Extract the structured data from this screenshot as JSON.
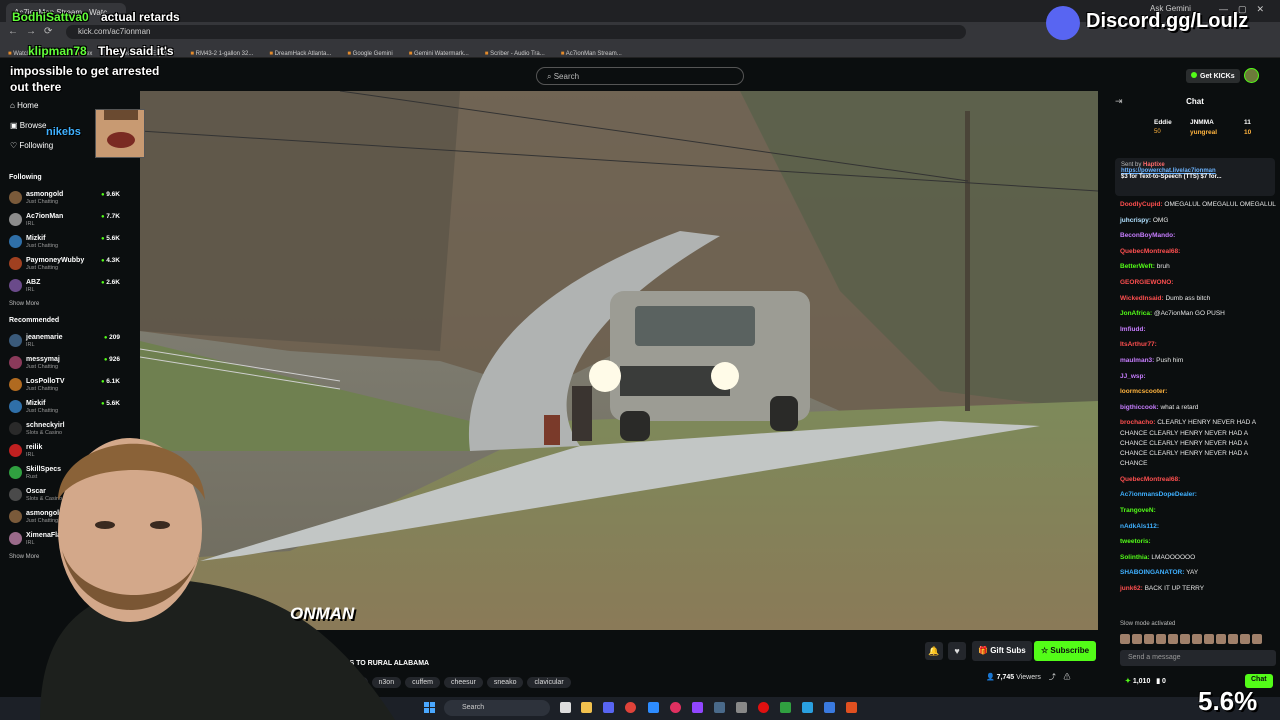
{
  "browser": {
    "tab_title": "Ac7ionMan Stream - Watc",
    "gemini_tab": "Ask Gemini",
    "url": "kick.com/ac7ionman",
    "bookmarks": [
      "Watch on Stream",
      "Plex",
      "Saved",
      "Explorer",
      "RM43-2 1-gallon 32...",
      "DreamHack Atlanta...",
      "Google Gemini",
      "Gemini Watermark...",
      "Scriber - Audio Tra...",
      "Ac7ionMan Stream..."
    ]
  },
  "header": {
    "search_placeholder": "Search",
    "get_kicks": "Get KICKs"
  },
  "sidebar": {
    "nav": [
      {
        "label": "Home",
        "icon": "home-icon"
      },
      {
        "label": "Browse",
        "icon": "browse-icon"
      },
      {
        "label": "Following",
        "icon": "heart-icon"
      }
    ],
    "following_heading": "Following",
    "following": [
      {
        "name": "asmongold",
        "category": "Just Chatting",
        "viewers": "9.6K",
        "color": "#7a5a3a"
      },
      {
        "name": "Ac7ionMan",
        "category": "IRL",
        "viewers": "7.7K",
        "color": "#8c8c8c"
      },
      {
        "name": "Mizkif",
        "category": "Just Chatting",
        "viewers": "5.6K",
        "color": "#2f6fa8"
      },
      {
        "name": "PaymoneyWubby",
        "category": "Just Chatting",
        "viewers": "4.3K",
        "color": "#a04020"
      },
      {
        "name": "ABZ",
        "category": "IRL",
        "viewers": "2.6K",
        "color": "#6a4a8a"
      }
    ],
    "show_more": "Show More",
    "recommended_heading": "Recommended",
    "recommended": [
      {
        "name": "jeanemarie",
        "category": "IRL",
        "viewers": "209",
        "color": "#3a5a7a"
      },
      {
        "name": "messymaj",
        "category": "Just Chatting",
        "viewers": "926",
        "color": "#8a3a5a"
      },
      {
        "name": "LosPolloTV",
        "category": "Just Chatting",
        "viewers": "6.1K",
        "color": "#b06a20"
      },
      {
        "name": "Mizkif",
        "category": "Just Chatting",
        "viewers": "5.6K",
        "color": "#2f6fa8"
      },
      {
        "name": "schneckyirl",
        "category": "Slots & Casino",
        "viewers": "",
        "color": "#2a2a2a"
      },
      {
        "name": "reilik",
        "category": "IRL",
        "viewers": "",
        "color": "#c02020"
      },
      {
        "name": "SkillSpecs",
        "category": "Rust",
        "viewers": "",
        "color": "#30a040"
      },
      {
        "name": "Oscar",
        "category": "Slots & Casino",
        "viewers": "",
        "color": "#4a4a4a"
      },
      {
        "name": "asmongold",
        "category": "Just Chatting",
        "viewers": "",
        "color": "#7a5a3a"
      },
      {
        "name": "XimenaFlaku",
        "category": "IRL",
        "viewers": "",
        "color": "#9a6a8a"
      }
    ],
    "show_more_2": "Show More"
  },
  "stream": {
    "title": "MPHIS TO RURAL ALABAMA",
    "tags": [
      "nman",
      "n3on",
      "cuffem",
      "cheesur",
      "sneako",
      "clavicular"
    ],
    "gift_subs": "Gift Subs",
    "subscribe": "Subscribe",
    "viewers": "7,745",
    "viewers_label": "Viewers",
    "watermark": "ONMAN"
  },
  "chat": {
    "title": "Chat",
    "leaderboard": [
      {
        "name": "Eddie",
        "value": "50"
      },
      {
        "name": "JNMMA",
        "value": "11"
      },
      {
        "name": "yungreal",
        "value": "10"
      }
    ],
    "pinned": {
      "sent_by": "Sent by",
      "sender": "Haptixe",
      "link": "https://powerchat.live/ac7ionman",
      "text": "$3 for Text-to-Speech (TTS) $7 for..."
    },
    "messages": [
      {
        "user": "DoodlyCupid:",
        "text": "OMEGALUL OMEGALUL OMEGALUL",
        "color": "#ff4f4f"
      },
      {
        "user": "juhcrispy:",
        "text": "OMG",
        "color": "#b0e0ff"
      },
      {
        "user": "BeconBoyMando:",
        "text": "",
        "color": "#c77dff"
      },
      {
        "user": "QuebecMontreal68:",
        "text": "",
        "color": "#ff4f4f"
      },
      {
        "user": "BetterWeft:",
        "text": "bruh",
        "color": "#53fc18"
      },
      {
        "user": "GEORGIEWONO:",
        "text": "",
        "color": "#ff4f4f"
      },
      {
        "user": "WickedInsaid:",
        "text": "Dumb ass bitch",
        "color": "#ff4f4f"
      },
      {
        "user": "JonAfrica:",
        "text": "@Ac7ionMan GO PUSH",
        "color": "#53fc18"
      },
      {
        "user": "Imfiudd:",
        "text": "",
        "color": "#c77dff"
      },
      {
        "user": "ItsArthur77:",
        "text": "",
        "color": "#ff4f4f"
      },
      {
        "user": "maulman3:",
        "text": "Push him",
        "color": "#c77dff"
      },
      {
        "user": "JJ_wsp:",
        "text": "",
        "color": "#c77dff"
      },
      {
        "user": "loormcscooter:",
        "text": "",
        "color": "#ffb33e"
      },
      {
        "user": "bigthiccook:",
        "text": "what a retard",
        "color": "#c77dff"
      },
      {
        "user": "brochacho:",
        "text": "CLEARLY HENRY NEVER HAD A CHANCE CLEARLY HENRY NEVER HAD A CHANCE CLEARLY HENRY NEVER HAD A CHANCE CLEARLY HENRY NEVER HAD A CHANCE",
        "color": "#ff4f4f"
      },
      {
        "user": "QuebecMontreal68:",
        "text": "",
        "color": "#ff4f4f"
      },
      {
        "user": "Ac7ionmansDopeDealer:",
        "text": "",
        "color": "#3fb0ff"
      },
      {
        "user": "TrangoveN:",
        "text": "",
        "color": "#53fc18"
      },
      {
        "user": "nAdkAls112:",
        "text": "",
        "color": "#3fb0ff"
      },
      {
        "user": "tweetoris:",
        "text": "",
        "color": "#53fc18"
      },
      {
        "user": "Solinthia:",
        "text": "LMAOOOOOO",
        "color": "#53fc18"
      },
      {
        "user": "SHABOINGANATOR:",
        "text": "YAY",
        "color": "#3fb0ff"
      },
      {
        "user": "junk62:",
        "text": "BACK IT UP TERRY",
        "color": "#ff4f4f"
      }
    ],
    "slow_mode": "Slow mode activated",
    "send_placeholder": "Send a message",
    "kicks": "1,010",
    "points": "0",
    "chat_button": "Chat"
  },
  "overlay": {
    "line1_user": "BodhiSattva0",
    "line1_msg": "actual  retards",
    "line2_user": "klipman78",
    "line2_msg": "They  said  it's",
    "line3_msg": "impossible  to  get  arrested  out  there",
    "line4_user": "nikebs",
    "discord": "Discord.gg/Loulz",
    "percent": "5.6%"
  },
  "taskbar": {
    "search": "Search"
  },
  "colors": {
    "kick_green": "#53fc18",
    "background": "#0b0e0f"
  }
}
